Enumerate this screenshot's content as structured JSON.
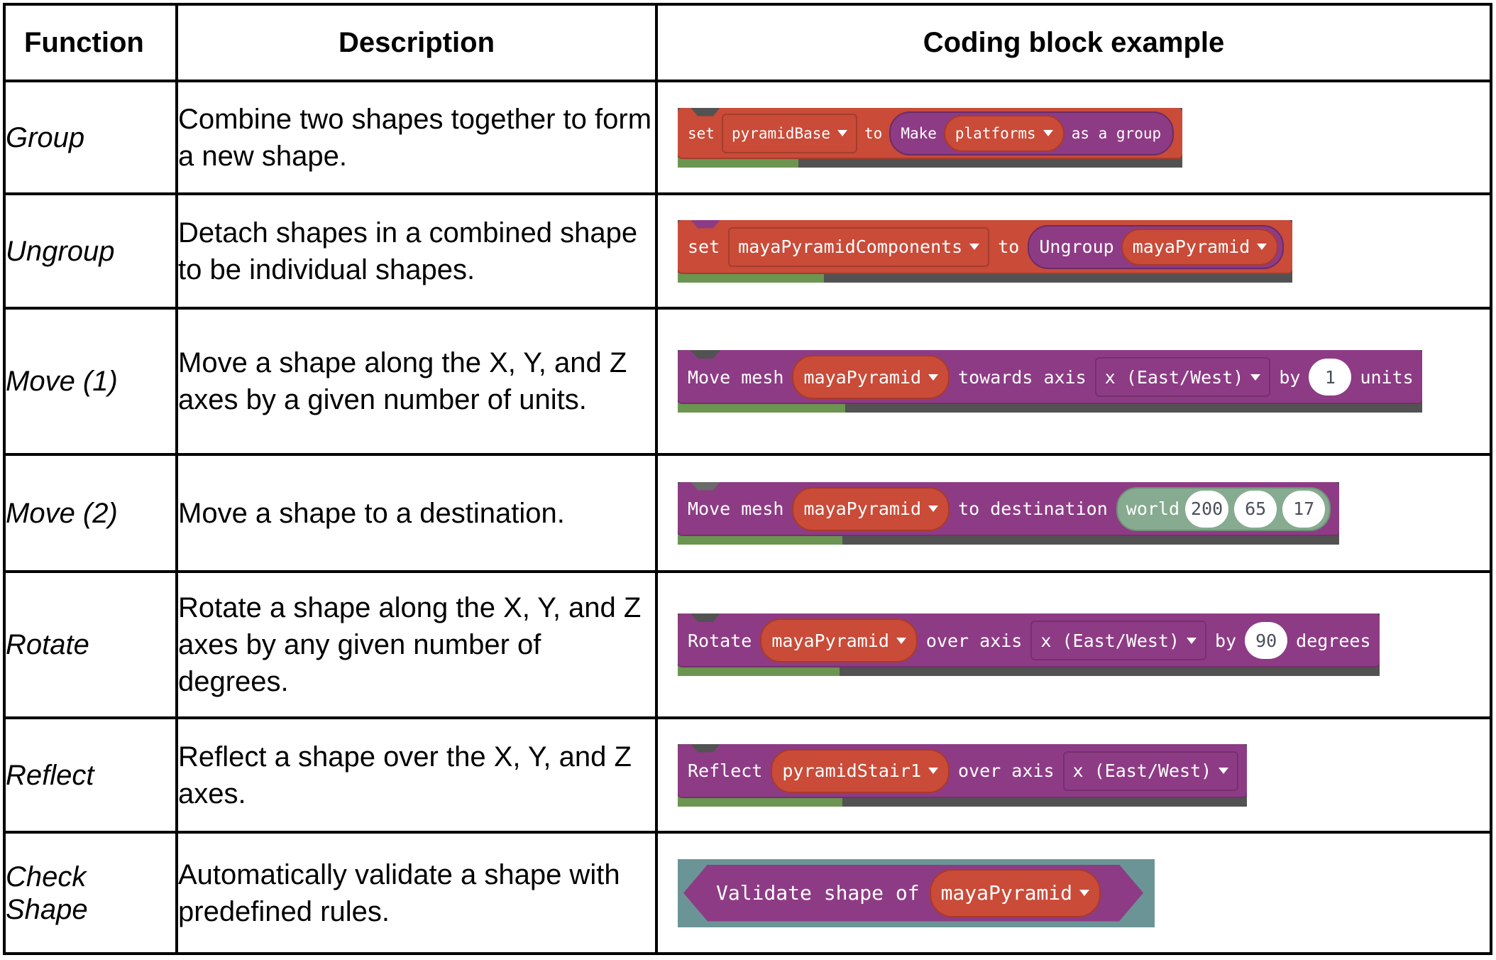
{
  "table": {
    "headers": [
      "Function",
      "Description",
      "Coding block example"
    ],
    "rows": [
      {
        "function": "Group",
        "description": "Combine two shapes together to form a new shape.",
        "block": {
          "set": "set",
          "var": "pyramidBase",
          "to": "to",
          "make": "Make",
          "arg": "platforms",
          "suffix": "as a group"
        }
      },
      {
        "function": "Ungroup",
        "description": "Detach shapes in a combined shape to be individual shapes.",
        "block": {
          "set": "set",
          "var": "mayaPyramidComponents",
          "to": "to",
          "ungroup": "Ungroup",
          "arg": "mayaPyramid"
        }
      },
      {
        "function": "Move (1)",
        "description": "Move a shape along the X, Y, and Z axes by a given number of units.",
        "block": {
          "label": "Move mesh",
          "mesh": "mayaPyramid",
          "towards": "towards axis",
          "axis": "x (East/West)",
          "by": "by",
          "value": "1",
          "units": "units"
        }
      },
      {
        "function": "Move (2)",
        "description": "Move a shape to a destination.",
        "block": {
          "label": "Move mesh",
          "mesh": "mayaPyramid",
          "to": "to destination",
          "world": "world",
          "x": "200",
          "y": "65",
          "z": "17"
        }
      },
      {
        "function": "Rotate",
        "description": "Rotate a shape along the X, Y, and Z axes by any given number of degrees.",
        "block": {
          "label": "Rotate",
          "mesh": "mayaPyramid",
          "over": "over axis",
          "axis": "x (East/West)",
          "by": "by",
          "value": "90",
          "units": "degrees"
        }
      },
      {
        "function": "Reflect",
        "description": "Reflect a shape over the X, Y, and Z axes.",
        "block": {
          "label": "Reflect",
          "mesh": "pyramidStair1",
          "over": "over axis",
          "axis": "x (East/West)"
        }
      },
      {
        "function": "Check Shape",
        "description": "Automatically validate a shape with predefined rules.",
        "block": {
          "label": "Validate shape of",
          "mesh": "mayaPyramid"
        }
      }
    ]
  },
  "colors": {
    "block_red": "#c94b38",
    "block_purple": "#8e3b85",
    "block_sage": "#86ab90",
    "workspace_teal": "#6b9496",
    "workspace_green": "#6b9550",
    "workspace_dark": "#525252"
  }
}
